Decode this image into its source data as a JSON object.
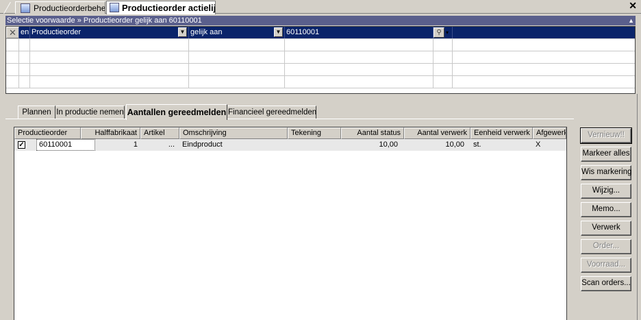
{
  "doc_tabs": [
    {
      "label": "Productieorderbeheer",
      "active": false
    },
    {
      "label": "Productieorder actielijst",
      "active": true
    }
  ],
  "selection_bar": {
    "text": "Selectie voorwaarde » Productieorder gelijk aan 60110001"
  },
  "criteria": {
    "rows": [
      {
        "logic": "en",
        "field": "Productieorder",
        "operator": "gelijk aan",
        "value": "60110001"
      }
    ]
  },
  "tabs": [
    {
      "label": "Plannen",
      "active": false
    },
    {
      "label": "In productie nemen",
      "active": false
    },
    {
      "label": "Aantallen gereedmelden",
      "active": true
    },
    {
      "label": "Financieel gereedmelden",
      "active": false
    }
  ],
  "grid": {
    "columns": [
      "Productieorder",
      "Halffabrikaat",
      "Artikel",
      "Omschrijving",
      "Tekening",
      "Aantal status",
      "Aantal verwerk",
      "Eenheid verwerk",
      "Afgewerk"
    ],
    "rows": [
      {
        "checked": true,
        "productieorder": "60110001",
        "halffabrikaat": "1",
        "artikel": "...",
        "omschrijving": "Eindproduct",
        "tekening": "",
        "aantal_status": "10,00",
        "aantal_verwerk": "10,00",
        "eenheid_verwerk": "st.",
        "afgewerkt": "X"
      }
    ]
  },
  "buttons": {
    "vernieuw": "Vernieuw!!",
    "markeer_alles": "Markeer alles",
    "wis_markering": "Wis markering",
    "wijzig": "Wijzig...",
    "memo": "Memo...",
    "verwerk": "Verwerk",
    "order": "Order...",
    "voorraad": "Voorraad...",
    "scan_orders": "Scan orders..."
  }
}
